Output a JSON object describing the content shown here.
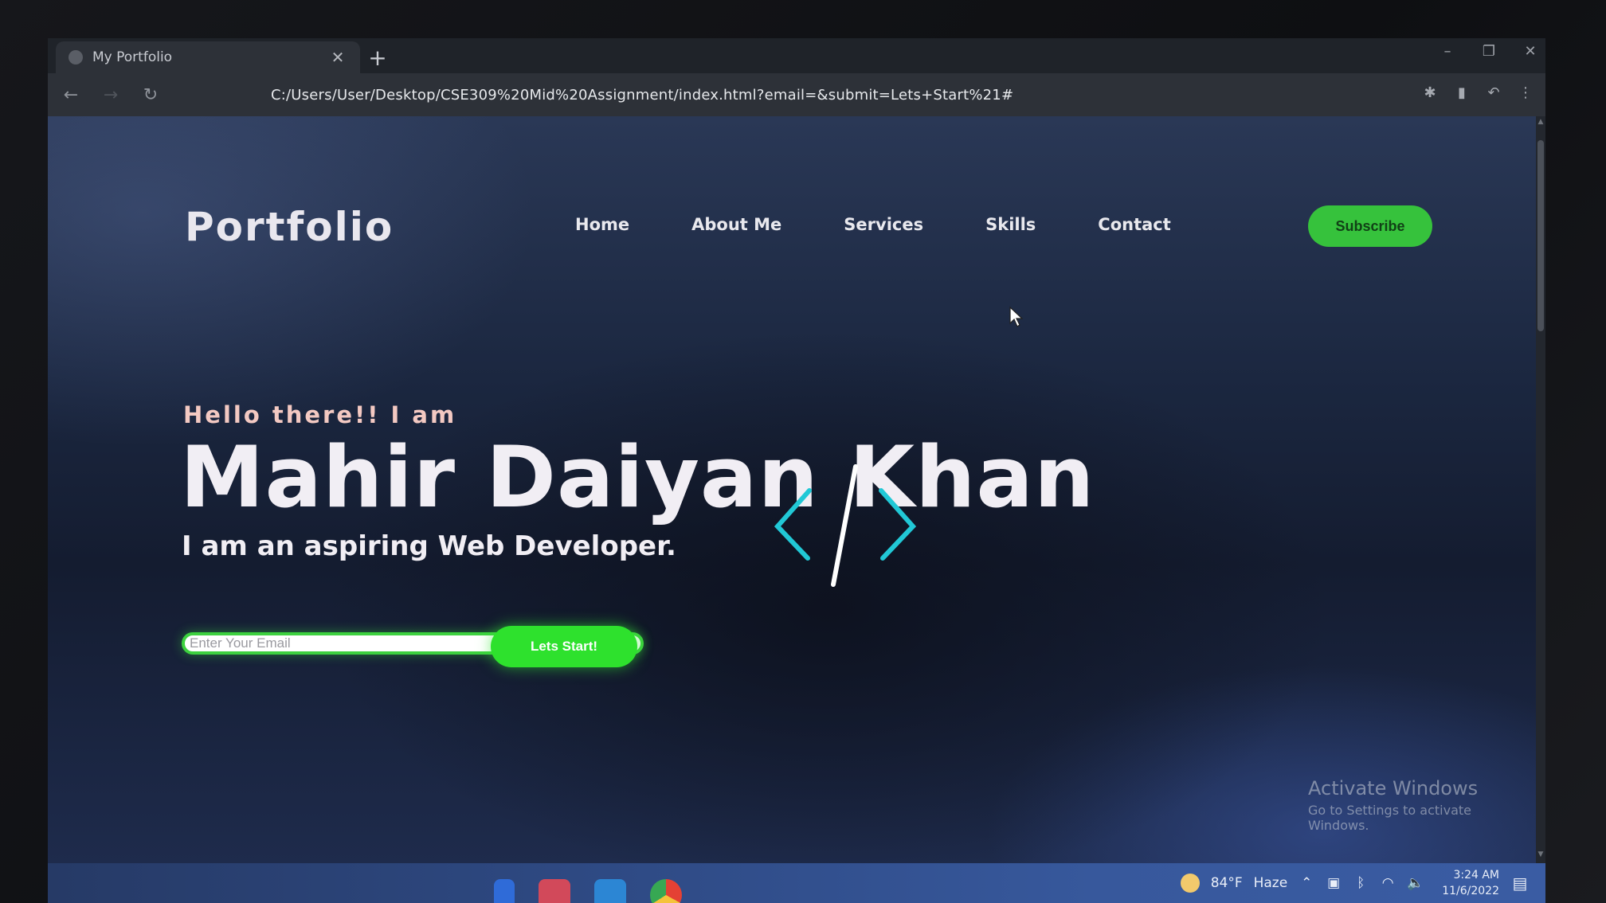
{
  "browser": {
    "tab_title": "My Portfolio",
    "tab_close": "✕",
    "new_tab": "+",
    "url": "C:/Users/User/Desktop/CSE309%20Mid%20Assignment/index.html?email=&submit=Lets+Start%21#",
    "window_controls": [
      "–",
      "❐",
      "✕"
    ]
  },
  "page": {
    "brand": "Portfolio",
    "nav": [
      "Home",
      "About Me",
      "Services",
      "Skills",
      "Contact"
    ],
    "subscribe_label": "Subscribe",
    "greeting": "Hello there!! I am",
    "name": "Mahir Daiyan Khan",
    "tagline": "I am an aspiring Web Developer.",
    "email_placeholder": "Enter Your Email",
    "start_label": "Lets Start!"
  },
  "watermark": {
    "title": "Activate Windows",
    "subtitle": "Go to Settings to activate Windows."
  },
  "taskbar": {
    "temperature": "84°F",
    "weather": "Haze",
    "time": "3:24 AM",
    "date": "11/6/2022"
  },
  "colors": {
    "accent_green": "#36c23c",
    "icon_cyan": "#21c8d6"
  }
}
